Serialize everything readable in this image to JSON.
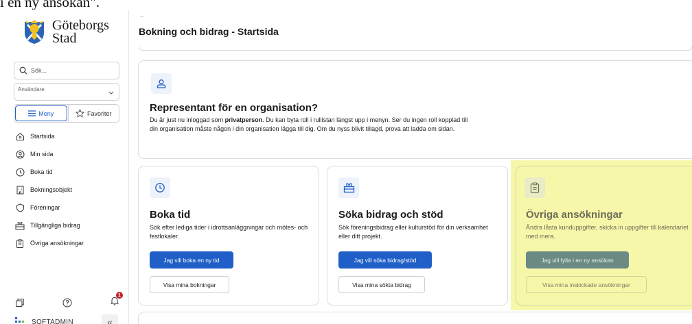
{
  "top_cut_text": "i en ny ansökan\".",
  "sidebar": {
    "logo_text_line1": "Göteborgs",
    "logo_text_line2": "Stad",
    "search_placeholder": "Sök...",
    "user_select_value": "Användare",
    "tabs": {
      "menu": "Meny",
      "favorites": "Favoriter"
    },
    "items": [
      {
        "label": "Startsida",
        "icon": "home-icon"
      },
      {
        "label": "Min sida",
        "icon": "user-circle-icon"
      },
      {
        "label": "Boka tid",
        "icon": "clock-icon"
      },
      {
        "label": "Bokningsobjekt",
        "icon": "building-icon"
      },
      {
        "label": "Föreningar",
        "icon": "shield-icon"
      },
      {
        "label": "Tillgängliga bidrag",
        "icon": "gift-icon"
      },
      {
        "label": "Övriga ansökningar",
        "icon": "clipboard-icon"
      }
    ],
    "notification_count": "1",
    "brand": "SOFTADMIN",
    "collapse_glyph": "«"
  },
  "main": {
    "back_glyph": "←",
    "page_title": "Bokning och bidrag - Startsida",
    "representative": {
      "title": "Representant för en organisation?",
      "text_before": "Du är just nu inloggad som ",
      "text_bold": "privatperson",
      "text_after": ". Du kan byta roll i rullistan längst upp i menyn. Ser du ingen roll kopplad till din organisation måste någon i din organisation lägga till dig. Om du nyss blivit tillagd, prova att ladda om sidan."
    },
    "cards": [
      {
        "title": "Boka tid",
        "text": "Sök efter lediga tider i idrottsanläggningar och mötes- och festlokaler.",
        "primary": "Jag vill boka en ny tid",
        "secondary": "Visa mina bokningar"
      },
      {
        "title": "Söka bidrag och stöd",
        "text": "Sök föreningsbidrag eller kulturstöd för din verksamhet eller ditt projekt.",
        "primary": "Jag vill söka bidrag/stöd",
        "secondary": "Visa mina sökta bidrag"
      },
      {
        "title": "Övriga ansökningar",
        "text": "Ändra låsta kunduppgifter, skicka in uppgifter till kalendariet med mera.",
        "primary": "Jag vill fylla i en ny ansökan",
        "secondary": "Visa mina inskickade ansökningar"
      }
    ]
  },
  "colors": {
    "primary": "#1f5fc7",
    "highlight": "#f7f7a9",
    "notification": "#c0232c"
  }
}
